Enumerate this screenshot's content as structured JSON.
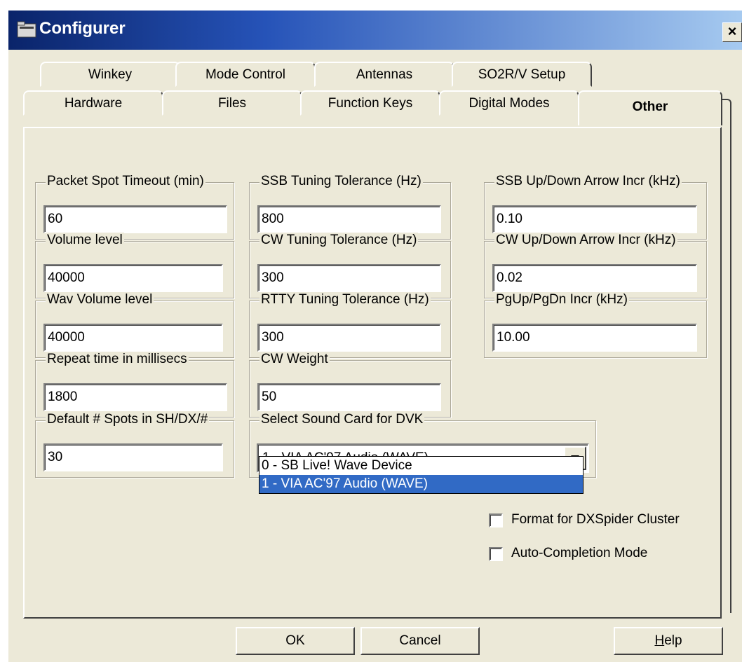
{
  "window": {
    "title": "Configurer",
    "close_label": "×"
  },
  "tabs_row1": [
    {
      "label": "Winkey"
    },
    {
      "label": "Mode Control"
    },
    {
      "label": "Antennas"
    },
    {
      "label": "SO2R/V Setup"
    }
  ],
  "tabs_row2": [
    {
      "label": "Hardware"
    },
    {
      "label": "Files"
    },
    {
      "label": "Function Keys"
    },
    {
      "label": "Digital Modes"
    },
    {
      "label": "Other"
    }
  ],
  "fields": {
    "packet_spot_timeout": {
      "label": "Packet Spot Timeout (min)",
      "value": "60"
    },
    "volume_level": {
      "label": "Volume level",
      "value": "40000"
    },
    "wav_volume_level": {
      "label": "Wav Volume level",
      "value": "40000"
    },
    "repeat_time": {
      "label": "Repeat time in millisecs",
      "value": "1800"
    },
    "default_spots": {
      "label": "Default # Spots in SH/DX/#",
      "value": "30"
    },
    "ssb_tuning": {
      "label": "SSB Tuning Tolerance (Hz)",
      "value": "800"
    },
    "cw_tuning": {
      "label": "CW Tuning Tolerance (Hz)",
      "value": "300"
    },
    "rtty_tuning": {
      "label": "RTTY Tuning Tolerance (Hz)",
      "value": "300"
    },
    "cw_weight": {
      "label": "CW Weight",
      "value": "50"
    },
    "ssb_arrow": {
      "label": "SSB Up/Down Arrow Incr (kHz)",
      "value": "0.10"
    },
    "cw_arrow": {
      "label": "CW Up/Down Arrow Incr (kHz)",
      "value": "0.02"
    },
    "pgupdn": {
      "label": "PgUp/PgDn Incr (kHz)",
      "value": "10.00"
    }
  },
  "sound_card": {
    "label": "Select Sound Card for DVK",
    "selected": "1 - VIA AC'97 Audio (WAVE)",
    "options": [
      "0 - SB Live! Wave Device",
      "1 - VIA AC'97 Audio (WAVE)"
    ]
  },
  "checkboxes": {
    "dxspider": {
      "label": "Format for DXSpider Cluster",
      "checked": false
    },
    "autocomplete": {
      "label": "Auto-Completion Mode",
      "checked": false
    }
  },
  "buttons": {
    "ok": "OK",
    "cancel": "Cancel",
    "help_prefix": "H",
    "help_rest": "elp"
  }
}
